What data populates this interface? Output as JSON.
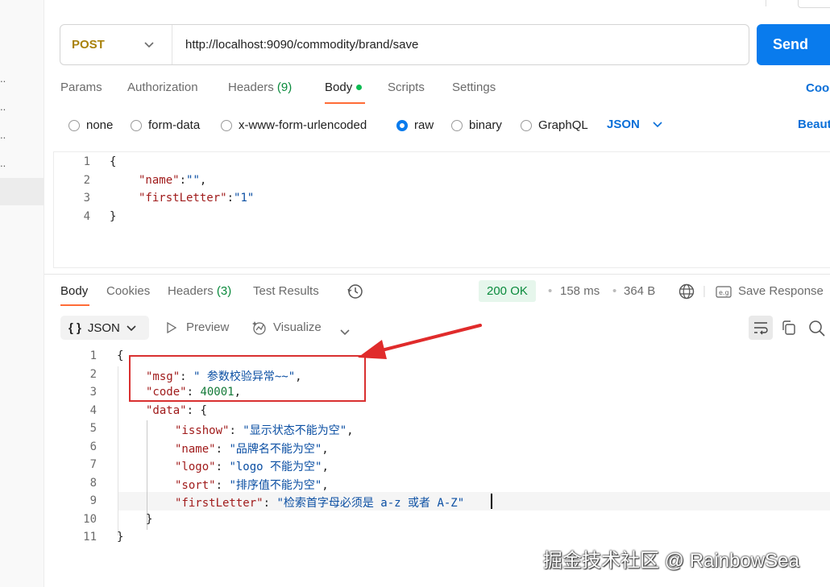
{
  "request": {
    "method": "POST",
    "url": "http://localhost:9090/commodity/brand/save",
    "send_label": "Send"
  },
  "request_tabs": [
    {
      "label": "Params"
    },
    {
      "label": "Authorization"
    },
    {
      "label": "Headers",
      "count": "(9)"
    },
    {
      "label": "Body"
    },
    {
      "label": "Scripts"
    },
    {
      "label": "Settings"
    }
  ],
  "cookies_link": "Coo",
  "beautify_link": "Beaut",
  "body_types": [
    "none",
    "form-data",
    "x-www-form-urlencoded",
    "raw",
    "binary",
    "GraphQL"
  ],
  "body_type_selected": "raw",
  "body_format": "JSON",
  "request_body_lines": [
    {
      "n": "1",
      "text": "{"
    },
    {
      "n": "2",
      "key": "\"name\"",
      "sep": ":",
      "val": "\"\"",
      "end": ","
    },
    {
      "n": "3",
      "key": "\"firstLetter\"",
      "sep": ":",
      "val": "\"1\"",
      "end": ""
    },
    {
      "n": "4",
      "text": "}"
    }
  ],
  "response_tabs": [
    {
      "label": "Body"
    },
    {
      "label": "Cookies"
    },
    {
      "label": "Headers",
      "count": "(3)"
    },
    {
      "label": "Test Results"
    }
  ],
  "response_meta": {
    "status": "200 OK",
    "time": "158 ms",
    "size": "364 B",
    "save": "Save Response"
  },
  "response_toolbar": {
    "format": "JSON",
    "format_icon": "{ }",
    "preview": "Preview",
    "visualize": "Visualize"
  },
  "response_body_lines": [
    {
      "n": "1",
      "text": "{"
    },
    {
      "n": "2",
      "key": "\"msg\"",
      "val": "\" 参数校验异常~~\"",
      "end": ","
    },
    {
      "n": "3",
      "key": "\"code\"",
      "num": "40001",
      "end": ","
    },
    {
      "n": "4",
      "key": "\"data\"",
      "text2": "{"
    },
    {
      "n": "5",
      "key": "\"isshow\"",
      "val": "\"显示状态不能为空\"",
      "end": ","
    },
    {
      "n": "6",
      "key": "\"name\"",
      "val": "\"品牌名不能为空\"",
      "end": ","
    },
    {
      "n": "7",
      "key": "\"logo\"",
      "val": "\"logo 不能为空\"",
      "end": ","
    },
    {
      "n": "8",
      "key": "\"sort\"",
      "val": "\"排序值不能为空\"",
      "end": ","
    },
    {
      "n": "9",
      "key": "\"firstLetter\"",
      "val": "\"检索首字母必须是 a-z 或者 A-Z\"",
      "end": ""
    },
    {
      "n": "10",
      "text": "}"
    },
    {
      "n": "11",
      "text": "}"
    }
  ],
  "watermark": "掘金技术社区 @ RainbowSea",
  "colors": {
    "accent_orange": "#ff6c37",
    "send_blue": "#097bed",
    "method_post": "#a9820b",
    "status_green": "#0a8a3c",
    "annotation_red": "#d93030"
  },
  "icons": [
    "chevron-down-icon",
    "history-icon",
    "globe-icon",
    "save-icon",
    "play-icon",
    "visualize-icon",
    "wrap-icon",
    "copy-icon",
    "search-icon"
  ]
}
